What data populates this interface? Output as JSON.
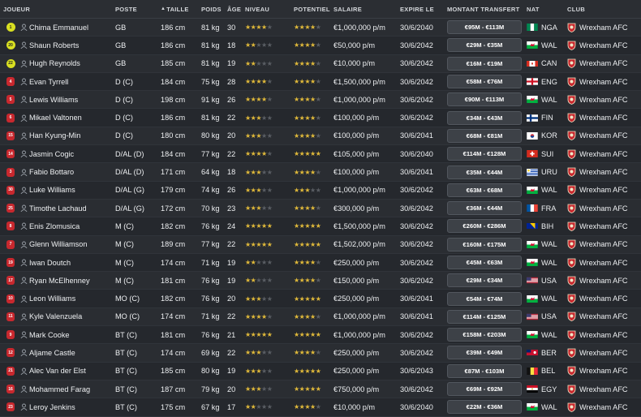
{
  "headers": {
    "joueur": "JOUEUR",
    "poste": "POSTE",
    "taille_arrow": "▲",
    "taille": "TAILLE",
    "poids": "POIDS",
    "age": "ÂGE",
    "niveau": "NIVEAU",
    "potentiel": "POTENTIEL",
    "salaire": "SALAIRE",
    "expire": "EXPIRE LE",
    "montant": "MONTANT TRANSFERT",
    "nat": "NAT",
    "club": "CLUB"
  },
  "colors": {
    "star": "#e0b93a",
    "goalkeeper_badge": "#d9e021",
    "outfield_badge": "#c8282e"
  },
  "players": [
    {
      "num": "1",
      "gk": true,
      "name": "Chima Emmanuel",
      "pos": "GB",
      "height": "186 cm",
      "weight": "81 kg",
      "age": "30",
      "cur": 3.5,
      "pot": 3.5,
      "wage": "€1,000,000 p/m",
      "expires": "30/6/2040",
      "value": "€95M - €113M",
      "nat": "NGA",
      "club": "Wrexham AFC"
    },
    {
      "num": "20",
      "gk": true,
      "name": "Shaun Roberts",
      "pos": "GB",
      "height": "186 cm",
      "weight": "81 kg",
      "age": "18",
      "cur": 2,
      "pot": 4,
      "wage": "€50,000 p/m",
      "expires": "30/6/2042",
      "value": "€29M - €35M",
      "nat": "WAL",
      "club": "Wrexham AFC"
    },
    {
      "num": "22",
      "gk": true,
      "name": "Hugh Reynolds",
      "pos": "GB",
      "height": "185 cm",
      "weight": "81 kg",
      "age": "19",
      "cur": 2,
      "pot": 3.5,
      "wage": "€10,000 p/m",
      "expires": "30/6/2042",
      "value": "€16M - €19M",
      "nat": "CAN",
      "club": "Wrexham AFC"
    },
    {
      "num": "4",
      "gk": false,
      "name": "Evan Tyrrell",
      "pos": "D (C)",
      "height": "184 cm",
      "weight": "75 kg",
      "age": "28",
      "cur": 3.5,
      "pot": 3.5,
      "wage": "€1,500,000 p/m",
      "expires": "30/6/2042",
      "value": "€58M - €76M",
      "nat": "ENG",
      "club": "Wrexham AFC"
    },
    {
      "num": "5",
      "gk": false,
      "name": "Lewis Williams",
      "pos": "D (C)",
      "height": "198 cm",
      "weight": "91 kg",
      "age": "26",
      "cur": 4,
      "pot": 4,
      "wage": "€1,000,000 p/m",
      "expires": "30/6/2042",
      "value": "€90M - €113M",
      "nat": "WAL",
      "club": "Wrexham AFC"
    },
    {
      "num": "6",
      "gk": false,
      "name": "Mikael Valtonen",
      "pos": "D (C)",
      "height": "186 cm",
      "weight": "81 kg",
      "age": "22",
      "cur": 3,
      "pot": 4,
      "wage": "€100,000 p/m",
      "expires": "30/6/2042",
      "value": "€34M - €43M",
      "nat": "FIN",
      "club": "Wrexham AFC"
    },
    {
      "num": "15",
      "gk": false,
      "name": "Han Kyung-Min",
      "pos": "D (C)",
      "height": "180 cm",
      "weight": "80 kg",
      "age": "20",
      "cur": 2.5,
      "pot": 4,
      "wage": "€100,000 p/m",
      "expires": "30/6/2041",
      "value": "€68M - €81M",
      "nat": "KOR",
      "club": "Wrexham AFC"
    },
    {
      "num": "14",
      "gk": false,
      "name": "Jasmin Cogic",
      "pos": "D/AL (D)",
      "height": "184 cm",
      "weight": "77 kg",
      "age": "22",
      "cur": 3.5,
      "pot": 4.5,
      "wage": "€105,000 p/m",
      "expires": "30/6/2040",
      "value": "€114M - €128M",
      "nat": "SUI",
      "club": "Wrexham AFC"
    },
    {
      "num": "3",
      "gk": false,
      "name": "Fabio Bottaro",
      "pos": "D/AL (D)",
      "height": "171 cm",
      "weight": "64 kg",
      "age": "18",
      "cur": 3,
      "pot": 4,
      "wage": "€100,000 p/m",
      "expires": "30/6/2041",
      "value": "€35M - €44M",
      "nat": "URU",
      "club": "Wrexham AFC"
    },
    {
      "num": "30",
      "gk": false,
      "name": "Luke Williams",
      "pos": "D/AL (G)",
      "height": "179 cm",
      "weight": "74 kg",
      "age": "26",
      "cur": 3,
      "pot": 3,
      "wage": "€1,000,000 p/m",
      "expires": "30/6/2042",
      "value": "€63M - €68M",
      "nat": "WAL",
      "club": "Wrexham AFC"
    },
    {
      "num": "25",
      "gk": false,
      "name": "Timothe Lachaud",
      "pos": "D/AL (G)",
      "height": "172 cm",
      "weight": "70 kg",
      "age": "23",
      "cur": 3,
      "pot": 3.5,
      "wage": "€300,000 p/m",
      "expires": "30/6/2042",
      "value": "€36M - €44M",
      "nat": "FRA",
      "club": "Wrexham AFC"
    },
    {
      "num": "8",
      "gk": false,
      "name": "Enis Zlomusica",
      "pos": "M (C)",
      "height": "182 cm",
      "weight": "76 kg",
      "age": "24",
      "cur": 4.5,
      "pot": 4.5,
      "wage": "€1,500,000 p/m",
      "expires": "30/6/2042",
      "value": "€260M - €286M",
      "nat": "BIH",
      "club": "Wrexham AFC"
    },
    {
      "num": "7",
      "gk": false,
      "name": "Glenn Williamson",
      "pos": "M (C)",
      "height": "189 cm",
      "weight": "77 kg",
      "age": "22",
      "cur": 4.5,
      "pot": 5,
      "wage": "€1,502,000 p/m",
      "expires": "30/6/2042",
      "value": "€160M - €175M",
      "nat": "WAL",
      "club": "Wrexham AFC"
    },
    {
      "num": "19",
      "gk": false,
      "name": "Iwan Doutch",
      "pos": "M (C)",
      "height": "174 cm",
      "weight": "71 kg",
      "age": "19",
      "cur": 2,
      "pot": 4,
      "wage": "€250,000 p/m",
      "expires": "30/6/2042",
      "value": "€45M - €63M",
      "nat": "WAL",
      "club": "Wrexham AFC"
    },
    {
      "num": "17",
      "gk": false,
      "name": "Ryan McElhenney",
      "pos": "M (C)",
      "height": "181 cm",
      "weight": "76 kg",
      "age": "19",
      "cur": 2,
      "pot": 3.5,
      "wage": "€150,000 p/m",
      "expires": "30/6/2042",
      "value": "€29M - €34M",
      "nat": "USA",
      "club": "Wrexham AFC"
    },
    {
      "num": "10",
      "gk": false,
      "name": "Leon Williams",
      "pos": "MO (C)",
      "height": "182 cm",
      "weight": "76 kg",
      "age": "20",
      "cur": 2.5,
      "pot": 4.5,
      "wage": "€250,000 p/m",
      "expires": "30/6/2041",
      "value": "€54M - €74M",
      "nat": "WAL",
      "club": "Wrexham AFC"
    },
    {
      "num": "11",
      "gk": false,
      "name": "Kyle Valenzuela",
      "pos": "MO (C)",
      "height": "174 cm",
      "weight": "71 kg",
      "age": "22",
      "cur": 4,
      "pot": 4,
      "wage": "€1,000,000 p/m",
      "expires": "30/6/2041",
      "value": "€114M - €125M",
      "nat": "USA",
      "club": "Wrexham AFC"
    },
    {
      "num": "9",
      "gk": false,
      "name": "Mark Cooke",
      "pos": "BT (C)",
      "height": "181 cm",
      "weight": "76 kg",
      "age": "21",
      "cur": 4.5,
      "pot": 5,
      "wage": "€1,000,000 p/m",
      "expires": "30/6/2042",
      "value": "€158M - €203M",
      "nat": "WAL",
      "club": "Wrexham AFC"
    },
    {
      "num": "12",
      "gk": false,
      "name": "Aljame Castle",
      "pos": "BT (C)",
      "height": "174 cm",
      "weight": "69 kg",
      "age": "22",
      "cur": 3,
      "pot": 4,
      "wage": "€250,000 p/m",
      "expires": "30/6/2042",
      "value": "€39M - €49M",
      "nat": "BER",
      "club": "Wrexham AFC"
    },
    {
      "num": "21",
      "gk": false,
      "name": "Alec Van der Elst",
      "pos": "BT (C)",
      "height": "185 cm",
      "weight": "80 kg",
      "age": "19",
      "cur": 3,
      "pot": 4.5,
      "wage": "€250,000 p/m",
      "expires": "30/6/2043",
      "value": "€87M - €103M",
      "nat": "BEL",
      "club": "Wrexham AFC"
    },
    {
      "num": "16",
      "gk": false,
      "name": "Mohammed Farag",
      "pos": "BT (C)",
      "height": "187 cm",
      "weight": "79 kg",
      "age": "20",
      "cur": 3,
      "pot": 4.5,
      "wage": "€750,000 p/m",
      "expires": "30/6/2042",
      "value": "€69M - €92M",
      "nat": "EGY",
      "club": "Wrexham AFC"
    },
    {
      "num": "23",
      "gk": false,
      "name": "Leroy Jenkins",
      "pos": "BT (C)",
      "height": "175 cm",
      "weight": "67 kg",
      "age": "17",
      "cur": 2,
      "pot": 3.5,
      "wage": "€10,000 p/m",
      "expires": "30/6/2040",
      "value": "€22M - €36M",
      "nat": "WAL",
      "club": "Wrexham AFC"
    }
  ]
}
